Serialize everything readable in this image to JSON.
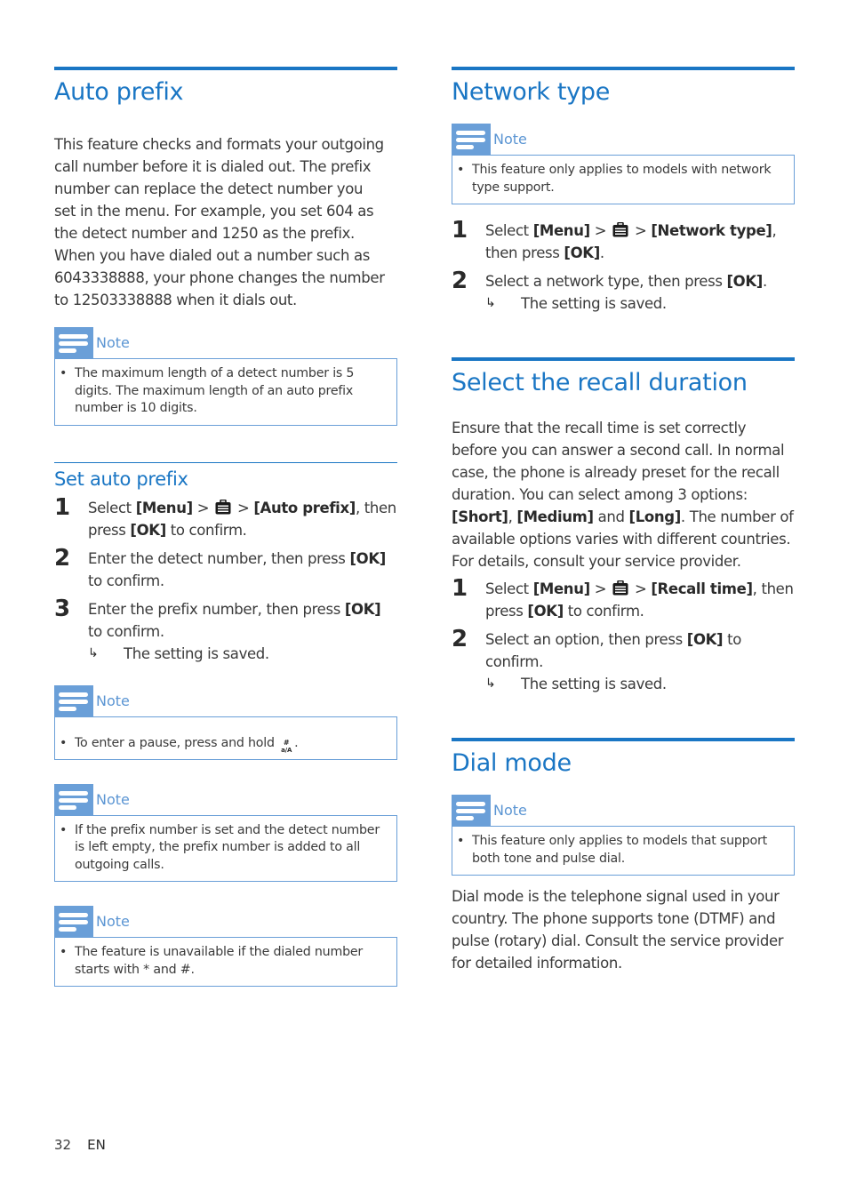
{
  "colors": {
    "accent": "#1a76c4",
    "note_tab": "#6a9fd8",
    "note_label": "#5b95d3"
  },
  "auto_prefix": {
    "title": "Auto prefix",
    "intro_lines": [
      "This feature checks and formats your outgoing",
      "call number before it is dialed out. The prefix",
      "number can replace the detect number you",
      "set in the menu. For example, you set 604 as",
      "the detect number and 1250 as the prefix.",
      "When you have dialed out a number such as",
      "6043338888, your phone changes the number",
      "to 12503338888 when it dials out."
    ],
    "note1": {
      "label": "Note",
      "icon": "note-icon",
      "text": "The maximum length of a detect number is 5 digits. The maximum length of an auto prefix number is 10 digits."
    },
    "subsection": {
      "title": "Set auto prefix",
      "steps": [
        {
          "num": "1",
          "pre": "Select ",
          "menu": "[Menu]",
          "sep1": " > ",
          "icon": "briefcase-icon",
          "sep2": " > ",
          "target": "[Auto prefix]",
          "post": ", then press ",
          "ok": "[OK]",
          "end": " to confirm."
        },
        {
          "num": "2",
          "pre": "Enter the detect number, then press ",
          "ok": "[OK]",
          "end": " to confirm."
        },
        {
          "num": "3",
          "pre": "Enter the prefix number, then press ",
          "ok": "[OK]",
          "end": " to confirm.",
          "result_arrow": "↳",
          "result": "The setting is saved."
        }
      ]
    },
    "note2": {
      "label": "Note",
      "text": "To enter a pause, press and hold ",
      "key_top": "#",
      "key_bottom": "a/A",
      "end": "."
    },
    "note3": {
      "label": "Note",
      "text": "If the prefix number is set and the detect number is left empty, the prefix number is added to all outgoing calls."
    },
    "note4": {
      "label": "Note",
      "text": "The feature is unavailable if the dialed number starts with * and #."
    }
  },
  "network_type": {
    "title": "Network type",
    "note": {
      "label": "Note",
      "text": "This feature only applies to models with network type support."
    },
    "steps": [
      {
        "num": "1",
        "pre": "Select ",
        "menu": "[Menu]",
        "sep1": " > ",
        "icon": "briefcase-icon",
        "sep2": " > ",
        "target": "[Network type]",
        "post": ", then press ",
        "ok": "[OK]",
        "end": "."
      },
      {
        "num": "2",
        "pre": "Select a network type, then press ",
        "ok": "[OK]",
        "end": ".",
        "result_arrow": "↳",
        "result": "The setting is saved."
      }
    ]
  },
  "recall": {
    "title": "Select the recall duration",
    "intro_pre": "Ensure that the recall time is set correctly before you can answer a second call. In normal case, the phone is already preset for the recall duration. You can select among 3 options: ",
    "opt_short": "[Short]",
    "comma": ", ",
    "opt_medium": "[Medium]",
    "and": " and ",
    "opt_long": "[Long]",
    "intro_post": ". The number of available options varies with different countries. For details, consult your service provider.",
    "steps": [
      {
        "num": "1",
        "pre": "Select ",
        "menu": "[Menu]",
        "sep1": " > ",
        "icon": "briefcase-icon",
        "sep2": " > ",
        "target": "[Recall time]",
        "post": ", then press ",
        "ok": "[OK]",
        "end": " to confirm."
      },
      {
        "num": "2",
        "pre": "Select an option, then press ",
        "ok": "[OK]",
        "end": " to confirm.",
        "result_arrow": "↳",
        "result": "The setting is saved."
      }
    ]
  },
  "dial_mode": {
    "title": "Dial mode",
    "note": {
      "label": "Note",
      "text": "This feature only applies to models that support both tone and pulse dial."
    },
    "body": "Dial mode is the telephone signal used in your country. The phone supports tone (DTMF) and pulse (rotary) dial. Consult the service provider for detailed information."
  },
  "footer": {
    "page_number": "32",
    "language": "EN"
  }
}
